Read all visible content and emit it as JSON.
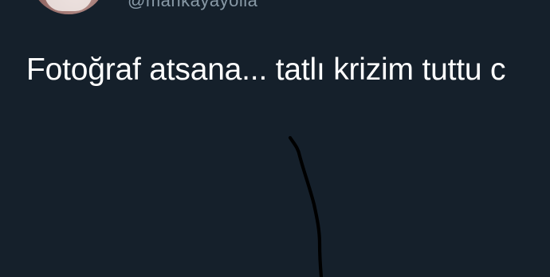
{
  "tweet": {
    "handle": "@mahkayayolla",
    "text": "Fotoğraf atsana... tatlı krizim tuttu c"
  },
  "colors": {
    "background": "#15202b",
    "text": "#ffffff",
    "handle": "#8899a6",
    "annotation_stroke": "#000000"
  }
}
